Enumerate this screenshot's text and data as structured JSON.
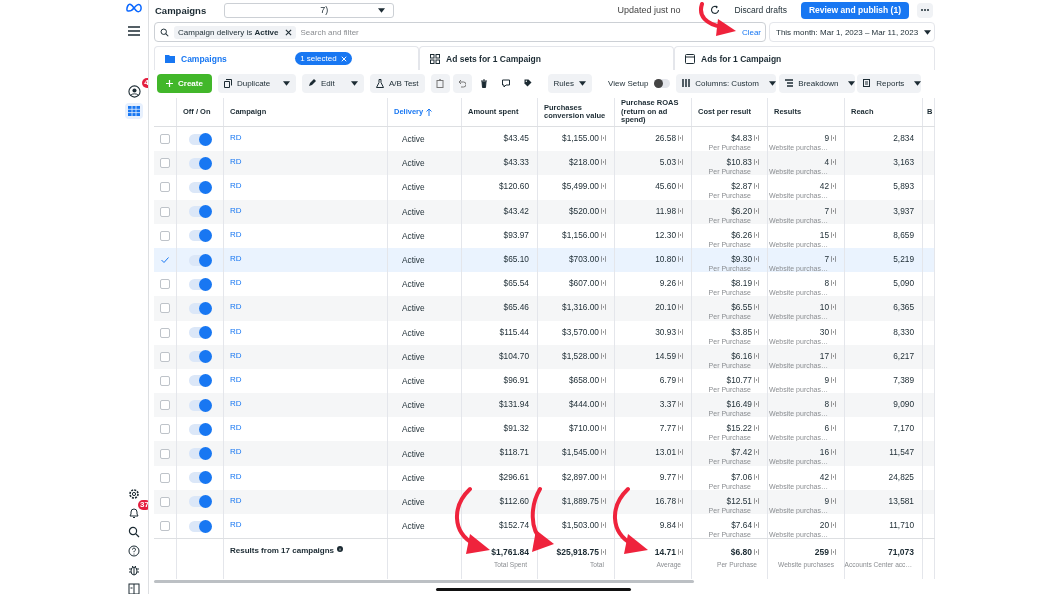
{
  "top_bar": {
    "title": "Campaigns",
    "account": "7)",
    "status": "Updated just no",
    "discard_button": "Discard drafts",
    "publish_button": "Review and publish (1)"
  },
  "sidebar": {
    "notifications_badge": "4",
    "alerts_badge": "37"
  },
  "filter_bar": {
    "filter_chip": "Campaign delivery is **Active**",
    "placeholder": "Search and filter",
    "clear_link": "Clear",
    "date_range": "This month: Mar 1, 2023 – Mar 11, 2023"
  },
  "tabs": [
    {
      "label": "Campaigns",
      "selected": true,
      "badge": "1 selected"
    },
    {
      "label": "Ad sets for 1 Campaign",
      "selected": false
    },
    {
      "label": "Ads for 1 Campaign",
      "selected": false
    }
  ],
  "toolbar": {
    "create": "Create",
    "duplicate": "Duplicate",
    "edit": "Edit",
    "ab_test": "A/B Test",
    "rules": "Rules",
    "view_setup": {
      "label": "View Setup",
      "on": false
    },
    "columns": "Columns: Custom",
    "breakdown": "Breakdown",
    "reports": "Reports"
  },
  "table": {
    "columns": [
      {
        "label": "Off / On",
        "sorted": false
      },
      {
        "label": "Campaign",
        "sorted": false
      },
      {
        "label": "Delivery",
        "sorted": true
      },
      {
        "label": "Amount spent",
        "sorted": false
      },
      {
        "label": "Purchases conversion value",
        "sorted": false
      },
      {
        "label": "Purchase ROAS (return on ad spend)",
        "sorted": false
      },
      {
        "label": "Cost per result",
        "sorted": false
      },
      {
        "label": "Results",
        "sorted": false
      },
      {
        "label": "Reach",
        "sorted": false
      },
      {
        "label": "B",
        "sorted": false
      }
    ],
    "rows": [
      {
        "checked": false,
        "on": true,
        "campaign": "RD",
        "delivery": "Active",
        "amount_spent": "$43.45",
        "conversion_value": "$1,155.00",
        "roas": "26.58",
        "cost_per_result": "$4.83",
        "cost_note": "Per Purchase",
        "results": "9",
        "results_note": "Website purchas…",
        "reach": "2,834"
      },
      {
        "checked": false,
        "on": true,
        "campaign": "RD",
        "delivery": "Active",
        "amount_spent": "$43.33",
        "conversion_value": "$218.00",
        "roas": "5.03",
        "cost_per_result": "$10.83",
        "cost_note": "Per Purchase",
        "results": "4",
        "results_note": "Website purchas…",
        "reach": "3,163"
      },
      {
        "checked": false,
        "on": true,
        "campaign": "RD",
        "delivery": "Active",
        "amount_spent": "$120.60",
        "conversion_value": "$5,499.00",
        "roas": "45.60",
        "cost_per_result": "$2.87",
        "cost_note": "Per Purchase",
        "results": "42",
        "results_note": "Website purchas…",
        "reach": "5,893"
      },
      {
        "checked": false,
        "on": true,
        "campaign": "RD",
        "delivery": "Active",
        "amount_spent": "$43.42",
        "conversion_value": "$520.00",
        "roas": "11.98",
        "cost_per_result": "$6.20",
        "cost_note": "Per Purchase",
        "results": "7",
        "results_note": "Website purchas…",
        "reach": "3,937"
      },
      {
        "checked": false,
        "on": true,
        "campaign": "RD",
        "delivery": "Active",
        "amount_spent": "$93.97",
        "conversion_value": "$1,156.00",
        "roas": "12.30",
        "cost_per_result": "$6.26",
        "cost_note": "Per Purchase",
        "results": "15",
        "results_note": "Website purchas…",
        "reach": "8,659"
      },
      {
        "checked": true,
        "on": true,
        "campaign": "RD",
        "delivery": "Active",
        "amount_spent": "$65.10",
        "conversion_value": "$703.00",
        "roas": "10.80",
        "cost_per_result": "$9.30",
        "cost_note": "Per Purchase",
        "results": "7",
        "results_note": "Website purchas…",
        "reach": "5,219"
      },
      {
        "checked": false,
        "on": true,
        "campaign": "RD",
        "delivery": "Active",
        "amount_spent": "$65.54",
        "conversion_value": "$607.00",
        "roas": "9.26",
        "cost_per_result": "$8.19",
        "cost_note": "Per Purchase",
        "results": "8",
        "results_note": "Website purchas…",
        "reach": "5,090"
      },
      {
        "checked": false,
        "on": true,
        "campaign": "RD",
        "delivery": "Active",
        "amount_spent": "$65.46",
        "conversion_value": "$1,316.00",
        "roas": "20.10",
        "cost_per_result": "$6.55",
        "cost_note": "Per Purchase",
        "results": "10",
        "results_note": "Website purchas…",
        "reach": "6,365"
      },
      {
        "checked": false,
        "on": true,
        "campaign": "RD",
        "delivery": "Active",
        "amount_spent": "$115.44",
        "conversion_value": "$3,570.00",
        "roas": "30.93",
        "cost_per_result": "$3.85",
        "cost_note": "Per Purchase",
        "results": "30",
        "results_note": "Website purchas…",
        "reach": "8,330"
      },
      {
        "checked": false,
        "on": true,
        "campaign": "RD",
        "delivery": "Active",
        "amount_spent": "$104.70",
        "conversion_value": "$1,528.00",
        "roas": "14.59",
        "cost_per_result": "$6.16",
        "cost_note": "Per Purchase",
        "results": "17",
        "results_note": "Website purchas…",
        "reach": "6,217"
      },
      {
        "checked": false,
        "on": true,
        "campaign": "RD",
        "delivery": "Active",
        "amount_spent": "$96.91",
        "conversion_value": "$658.00",
        "roas": "6.79",
        "cost_per_result": "$10.77",
        "cost_note": "Per Purchase",
        "results": "9",
        "results_note": "Website purchas…",
        "reach": "7,389"
      },
      {
        "checked": false,
        "on": true,
        "campaign": "RD",
        "delivery": "Active",
        "amount_spent": "$131.94",
        "conversion_value": "$444.00",
        "roas": "3.37",
        "cost_per_result": "$16.49",
        "cost_note": "Per Purchase",
        "results": "8",
        "results_note": "Website purchas…",
        "reach": "9,090"
      },
      {
        "checked": false,
        "on": true,
        "campaign": "RD",
        "delivery": "Active",
        "amount_spent": "$91.32",
        "conversion_value": "$710.00",
        "roas": "7.77",
        "cost_per_result": "$15.22",
        "cost_note": "Per Purchase",
        "results": "6",
        "results_note": "Website purchas…",
        "reach": "7,170"
      },
      {
        "checked": false,
        "on": true,
        "campaign": "RD",
        "delivery": "Active",
        "amount_spent": "$118.71",
        "conversion_value": "$1,545.00",
        "roas": "13.01",
        "cost_per_result": "$7.42",
        "cost_note": "Per Purchase",
        "results": "16",
        "results_note": "Website purchas…",
        "reach": "11,547"
      },
      {
        "checked": false,
        "on": true,
        "campaign": "RD",
        "delivery": "Active",
        "amount_spent": "$296.61",
        "conversion_value": "$2,897.00",
        "roas": "9.77",
        "cost_per_result": "$7.06",
        "cost_note": "Per Purchase",
        "results": "42",
        "results_note": "Website purchas…",
        "reach": "24,825"
      },
      {
        "checked": false,
        "on": true,
        "campaign": "RD",
        "delivery": "Active",
        "amount_spent": "$112.60",
        "conversion_value": "$1,889.75",
        "roas": "16.78",
        "cost_per_result": "$12.51",
        "cost_note": "Per Purchase",
        "results": "9",
        "results_note": "Website purchas…",
        "reach": "13,581"
      },
      {
        "checked": false,
        "on": true,
        "campaign": "RD",
        "delivery": "Active",
        "amount_spent": "$152.74",
        "conversion_value": "$1,503.00",
        "roas": "9.84",
        "cost_per_result": "$7.64",
        "cost_note": "Per Purchase",
        "results": "20",
        "results_note": "Website purchas…",
        "reach": "11,710"
      }
    ],
    "footer": {
      "label": "Results from 17 campaigns",
      "amount_spent": "$1,761.84",
      "amount_note": "Total Spent",
      "conversion_value": "$25,918.75",
      "conversion_note": "Total",
      "roas": "14.71",
      "roas_note": "Average",
      "cost_per_result": "$6.80",
      "cost_note": "Per Purchase",
      "results": "259",
      "results_note": "Website purchases",
      "reach": "71,073",
      "reach_note": "Accounts Center acc…"
    }
  }
}
